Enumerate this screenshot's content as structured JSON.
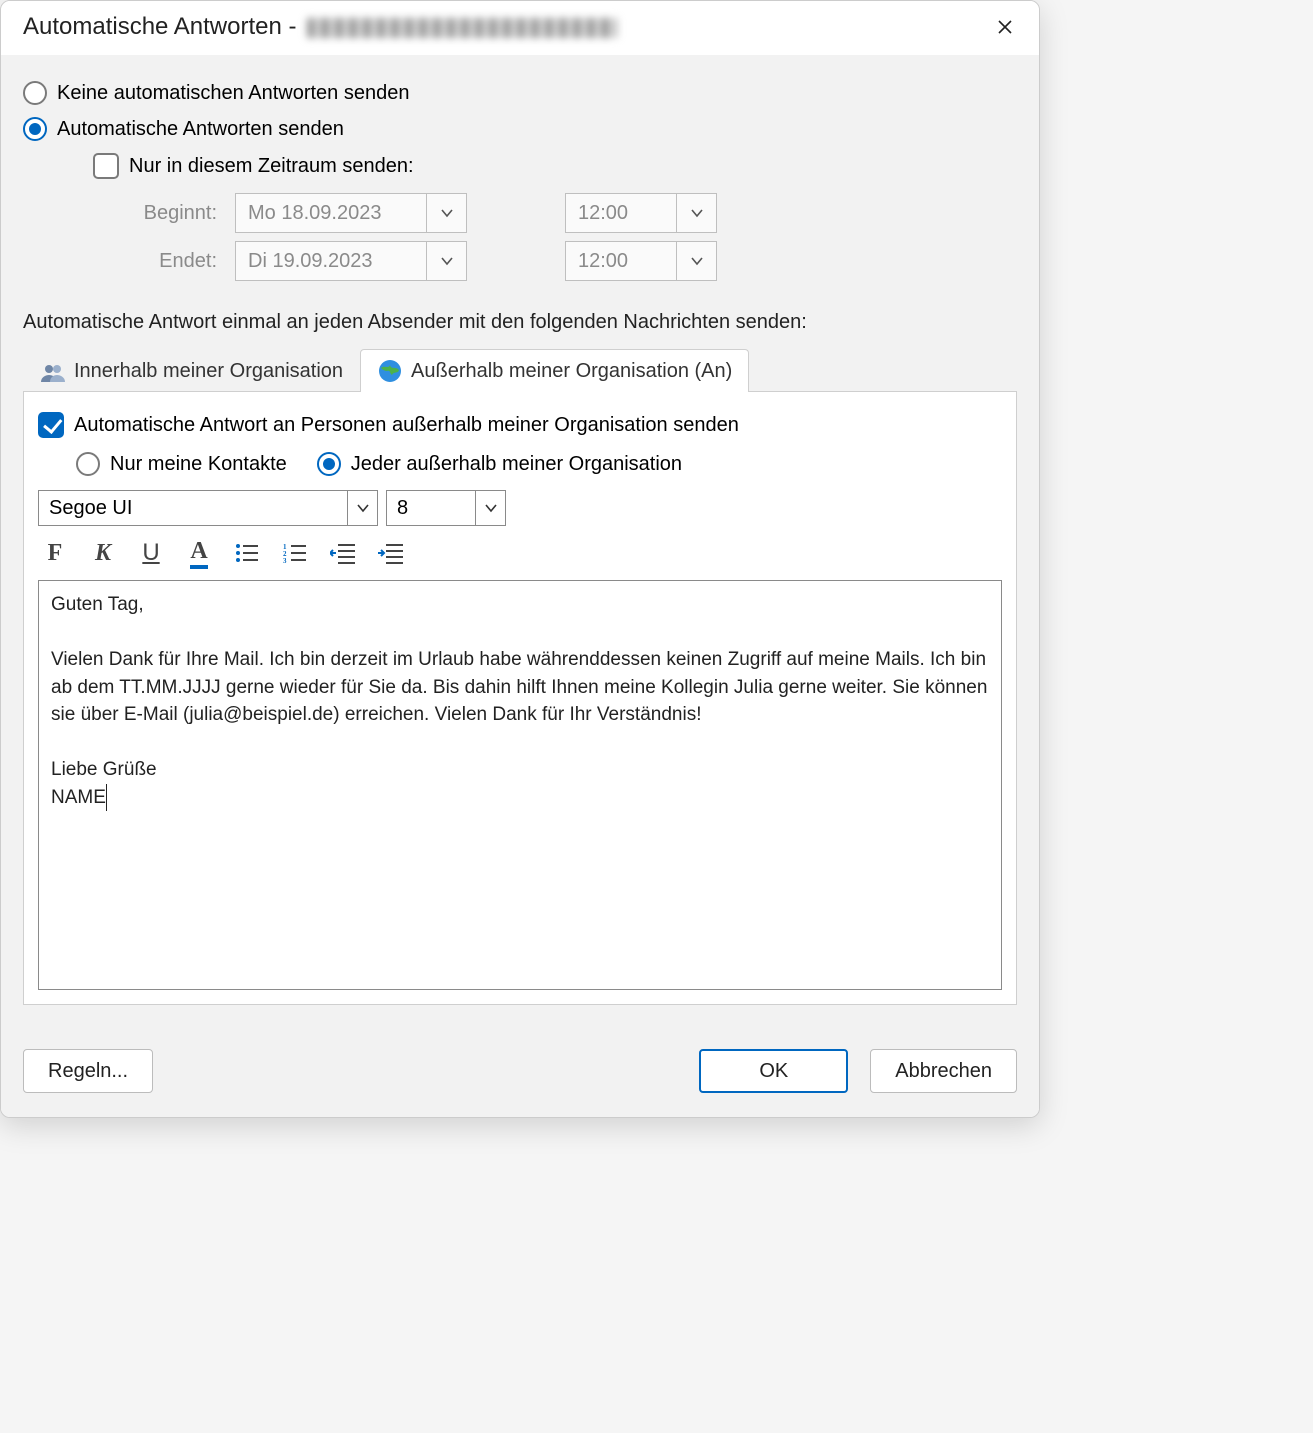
{
  "title_prefix": "Automatische Antworten - ",
  "radios": {
    "no_auto": "Keine automatischen Antworten senden",
    "send_auto": "Automatische Antworten senden"
  },
  "timerange": {
    "check_label": "Nur in diesem Zeitraum senden:",
    "start_label": "Beginnt:",
    "end_label": "Endet:",
    "start_date": "Mo 18.09.2023",
    "end_date": "Di 19.09.2023",
    "start_time": "12:00",
    "end_time": "12:00"
  },
  "instruction": "Automatische Antwort einmal an jeden Absender mit den folgenden Nachrichten senden:",
  "tabs": {
    "inside": "Innerhalb meiner Organisation",
    "outside": "Außerhalb meiner Organisation (An)"
  },
  "outside": {
    "check_label": "Automatische Antwort an Personen außerhalb meiner Organisation senden",
    "contacts_only": "Nur meine Kontakte",
    "everyone": "Jeder außerhalb meiner Organisation"
  },
  "font": {
    "name": "Segoe UI",
    "size": "8"
  },
  "toolbar": {
    "bold": "F",
    "italic": "K",
    "underline": "U",
    "fontcolor": "A"
  },
  "message_lines": [
    "Guten Tag,",
    "",
    "Vielen Dank für Ihre Mail. Ich bin derzeit im Urlaub habe währenddessen keinen Zugriff auf meine Mails. Ich bin ab dem TT.MM.JJJJ gerne wieder für Sie da. Bis dahin hilft Ihnen meine Kollegin Julia gerne weiter. Sie können sie über E-Mail (julia@beispiel.de) erreichen. Vielen Dank für Ihr Verständnis!",
    "",
    "Liebe Grüße",
    "NAME"
  ],
  "buttons": {
    "rules": "Regeln...",
    "ok": "OK",
    "cancel": "Abbrechen"
  }
}
